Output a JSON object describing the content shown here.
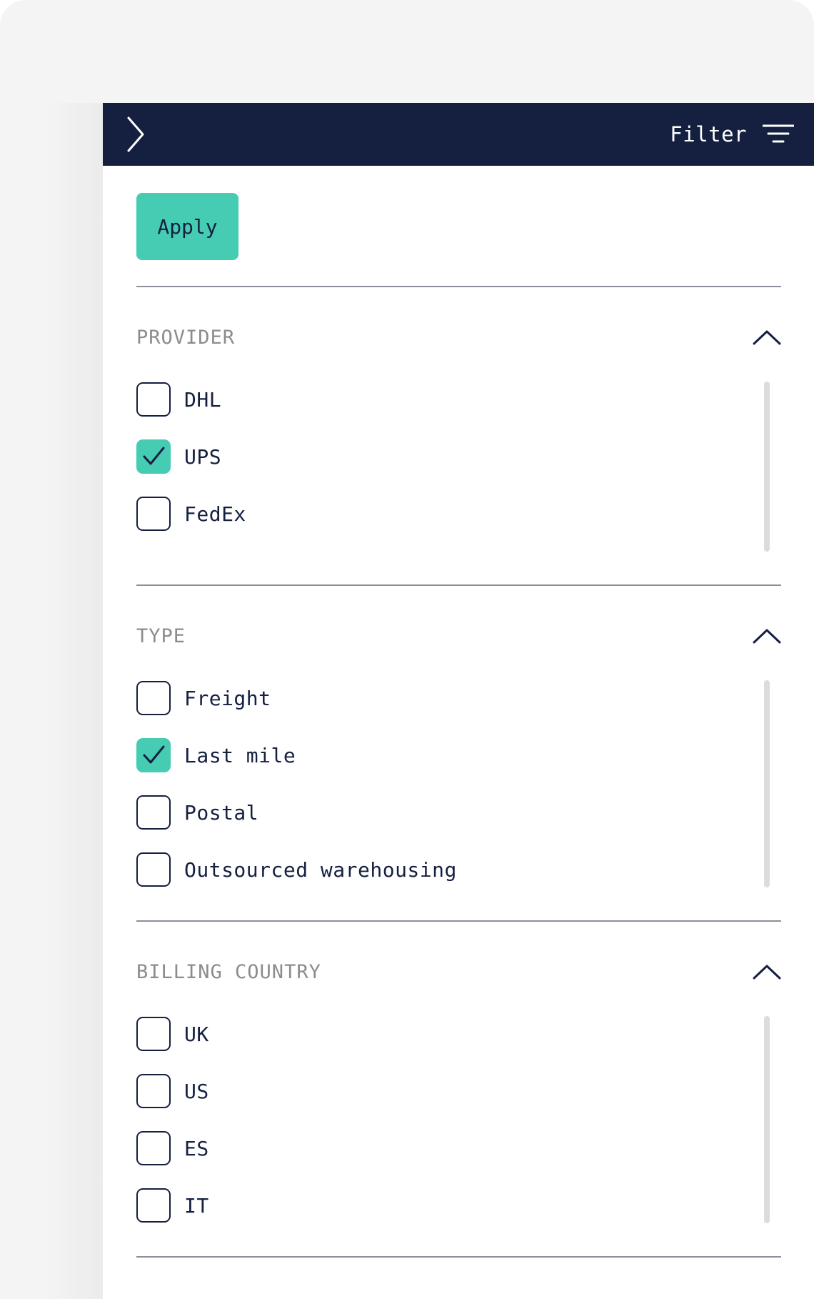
{
  "header": {
    "collapse_icon": "chevron-right-icon",
    "filter_label": "Filter",
    "filter_icon": "filter-lines-icon"
  },
  "apply_label": "Apply",
  "colors": {
    "header_bg": "#152040",
    "accent": "#45ccb2",
    "section_title": "#8c8c8c",
    "text": "#152040"
  },
  "sections": [
    {
      "title": "PROVIDER",
      "toggle_icon": "chevron-up-icon",
      "options": [
        {
          "label": "DHL",
          "checked": false
        },
        {
          "label": "UPS",
          "checked": true
        },
        {
          "label": "FedEx",
          "checked": false
        }
      ]
    },
    {
      "title": "TYPE",
      "toggle_icon": "chevron-up-icon",
      "options": [
        {
          "label": "Freight",
          "checked": false
        },
        {
          "label": "Last mile",
          "checked": true
        },
        {
          "label": "Postal",
          "checked": false
        },
        {
          "label": "Outsourced warehousing",
          "checked": false
        }
      ]
    },
    {
      "title": "BILLING COUNTRY",
      "toggle_icon": "chevron-up-icon",
      "options": [
        {
          "label": "UK",
          "checked": false
        },
        {
          "label": "US",
          "checked": false
        },
        {
          "label": "ES",
          "checked": false
        },
        {
          "label": "IT",
          "checked": false
        }
      ]
    }
  ]
}
